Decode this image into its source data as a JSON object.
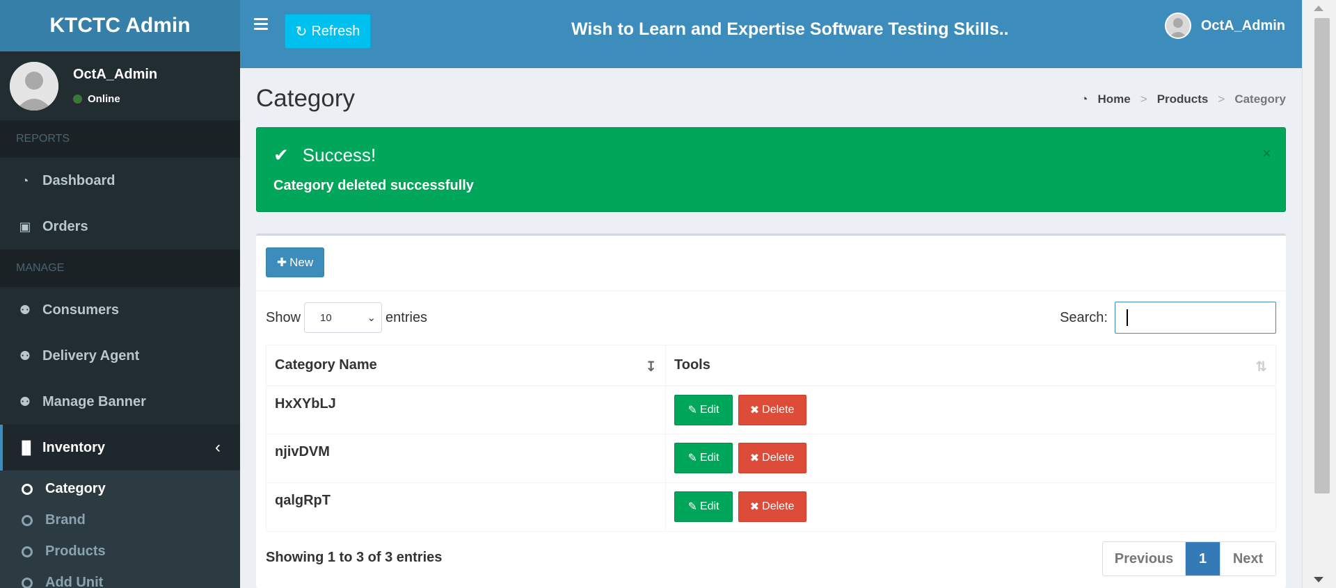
{
  "app": {
    "logo_text": "KTCTC Admin"
  },
  "navbar": {
    "refresh_label": "Refresh",
    "marquee_text": "Wish to Learn and Expertise Software Testing Skills...!!! Y",
    "user_name": "OctA_Admin"
  },
  "sidebar": {
    "user_name": "OctA_Admin",
    "user_status": "Online",
    "section_reports": "REPORTS",
    "section_manage": "MANAGE",
    "items": [
      {
        "label": "Dashboard",
        "icon": "dashboard-icon"
      },
      {
        "label": "Orders",
        "icon": "money-icon"
      },
      {
        "label": "Consumers",
        "icon": "users-icon"
      },
      {
        "label": "Delivery Agent",
        "icon": "users-icon"
      },
      {
        "label": "Manage Banner",
        "icon": "users-icon"
      },
      {
        "label": "Inventory",
        "icon": "barcode-icon"
      }
    ],
    "submenu": [
      {
        "label": "Category"
      },
      {
        "label": "Brand"
      },
      {
        "label": "Products"
      },
      {
        "label": "Add Unit"
      }
    ]
  },
  "page": {
    "title": "Category",
    "breadcrumb": [
      "Home",
      "Products",
      "Category"
    ]
  },
  "alert": {
    "title": "Success!",
    "message": "Category deleted successfully",
    "close_symbol": "×"
  },
  "table_controls": {
    "new_label": "New",
    "show_label": "Show",
    "entries_label": "entries",
    "page_length": "10",
    "search_label": "Search:",
    "search_value": ""
  },
  "table": {
    "columns": [
      "Category Name",
      "Tools"
    ],
    "rows": [
      {
        "name": "HxXYbLJ"
      },
      {
        "name": "njivDVM"
      },
      {
        "name": "qalgRpT"
      }
    ],
    "edit_label": "Edit",
    "delete_label": "Delete"
  },
  "footer": {
    "info": "Showing 1 to 3 of 3 entries",
    "prev_label": "Previous",
    "current_page": "1",
    "next_label": "Next"
  },
  "colors": {
    "primary": "#3c8dbc",
    "success": "#00a65a",
    "danger": "#dd4b39",
    "info": "#00c0ef",
    "sidebar": "#222d32"
  }
}
